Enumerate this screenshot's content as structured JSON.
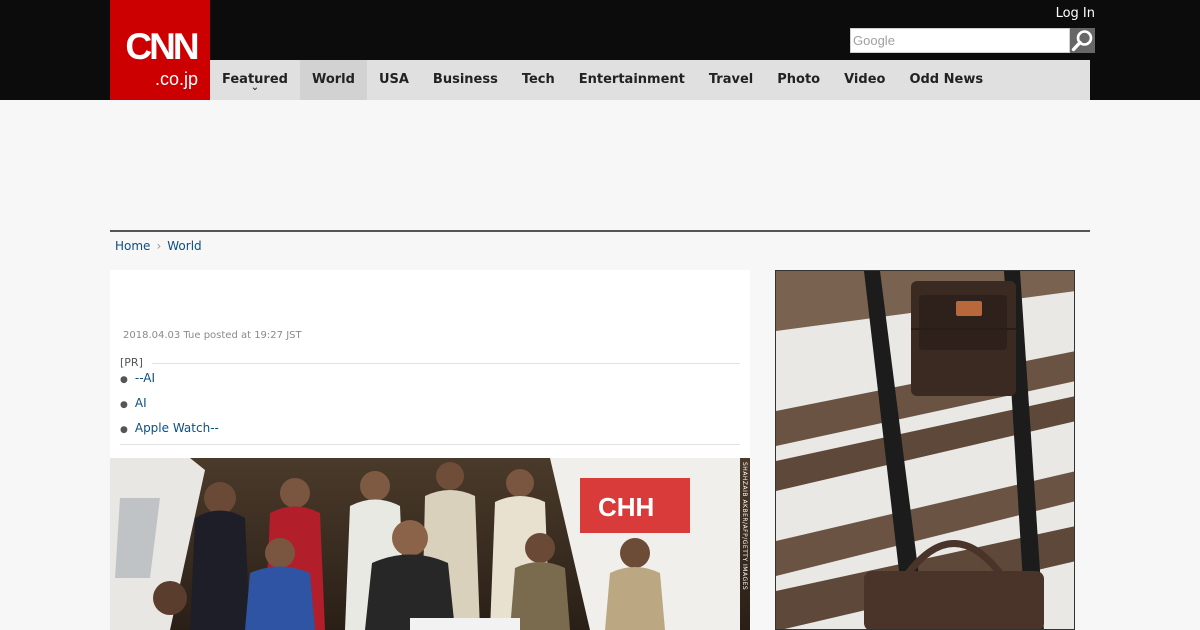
{
  "header": {
    "logo_main": "CNN",
    "logo_sub": ".co.jp",
    "login_label": "Log In",
    "search_placeholder": "Google"
  },
  "nav": {
    "items": [
      {
        "label": "Featured",
        "dropdown": true
      },
      {
        "label": "World",
        "active": true
      },
      {
        "label": "USA"
      },
      {
        "label": "Business"
      },
      {
        "label": "Tech"
      },
      {
        "label": "Entertainment"
      },
      {
        "label": "Travel"
      },
      {
        "label": "Photo"
      },
      {
        "label": "Video"
      },
      {
        "label": "Odd News"
      }
    ]
  },
  "breadcrumb": {
    "home": "Home",
    "current": "World"
  },
  "article": {
    "posted": "2018.04.03 Tue posted at 19:27 JST",
    "pr_label": "[PR]",
    "pr_links": [
      "--AI",
      "AI",
      "Apple Watch--"
    ],
    "photo_credit": "SHAHZAIB AKBER/AFP/GETTY IMAGES"
  },
  "colors": {
    "brand_red": "#cc0000",
    "header_bg": "#0c0c0c",
    "nav_bg": "#e0e0e0",
    "link": "#0b4f83"
  }
}
